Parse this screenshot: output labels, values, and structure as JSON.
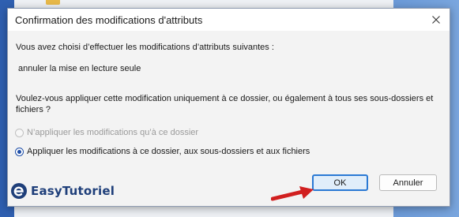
{
  "dialog": {
    "title": "Confirmation des modifications d'attributs",
    "intro": "Vous avez choisi d’effectuer les modifications d’attributs suivantes :",
    "attribute_change": "annuler la mise en lecture seule",
    "question": "Voulez-vous appliquer cette modification uniquement à ce dossier, ou également à tous ses sous-dossiers et fichiers ?",
    "options": [
      {
        "label": "N’appliquer les modifications qu’à ce dossier",
        "selected": false,
        "enabled": false
      },
      {
        "label": "Appliquer les modifications à ce dossier, aux sous-dossiers et aux fichiers",
        "selected": true,
        "enabled": true
      }
    ],
    "ok_label": "OK",
    "cancel_label": "Annuler"
  },
  "watermark": {
    "brand": "EasyTutoriel"
  },
  "colors": {
    "accent": "#2a79d4",
    "arrow": "#d11f1f",
    "logo": "#1f3f7a"
  }
}
